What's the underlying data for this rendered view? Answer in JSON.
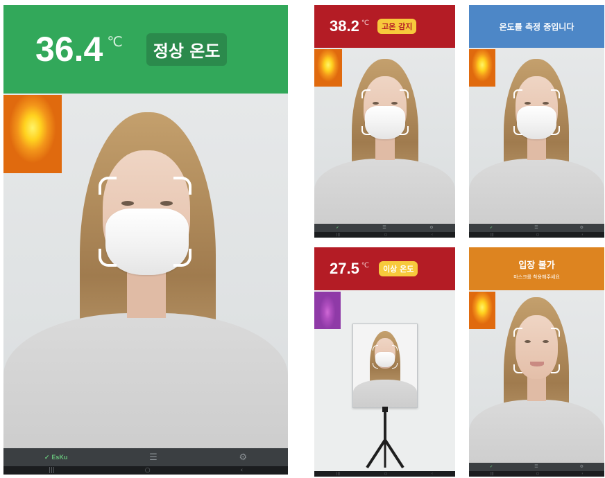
{
  "main_screen": {
    "temperature": "36.4",
    "unit": "℃",
    "status": "정상 온도",
    "banner_color": "#32a85a",
    "appbar": {
      "brand_icon": "shield-icon",
      "brand_label": "EsKu",
      "center_icon": "menu-icon",
      "right_icon": "gear-icon"
    }
  },
  "screen_high": {
    "temperature": "38.2",
    "unit": "℃",
    "status": "고온 감지",
    "banner_color": "#b41c25",
    "status_text_color": "#b41c25",
    "status_bg": "#f7c93c"
  },
  "screen_measuring": {
    "message": "온도를 측정 중입니다",
    "banner_color": "#4d87c7"
  },
  "screen_abnormal": {
    "temperature": "27.5",
    "unit": "℃",
    "status": "이상 온도",
    "banner_color": "#b41c25",
    "status_bg": "#f7c93c"
  },
  "screen_denied": {
    "title": "입장 불가",
    "subtitle": "마스크를 착용해주세요",
    "banner_color": "#dd8420"
  },
  "system_nav": {
    "recent_icon": "recent-apps-icon",
    "home_icon": "home-icon",
    "back_icon": "back-icon"
  }
}
